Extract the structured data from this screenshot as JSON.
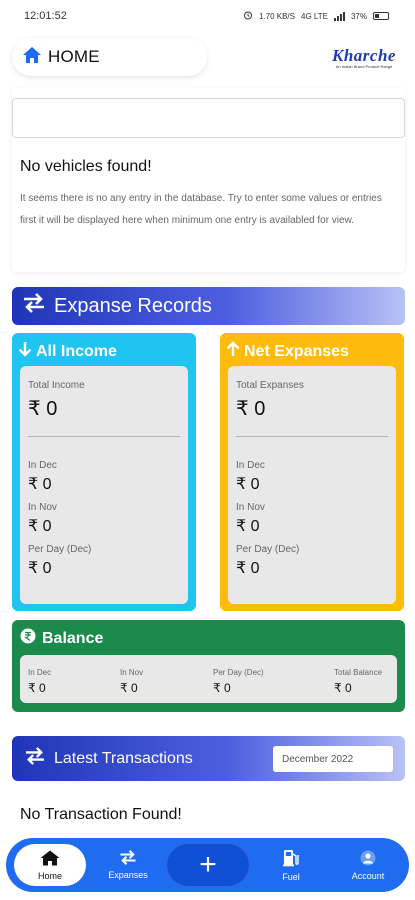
{
  "status": {
    "time": "12:01:52",
    "net_rate": "1.70 KB/S",
    "net_type": "4G LTE",
    "battery": "37%"
  },
  "header": {
    "title": "HOME",
    "logo_text": "Kharche",
    "logo_tagline": "An Indian Brand Product Range"
  },
  "vehicles": {
    "search_value": "",
    "empty_title": "No vehicles found!",
    "empty_text": "It seems there is no any entry in the database. Try to enter some values or entries first it will be displayed here when minimum one entry is availabled for view."
  },
  "expanse_records": {
    "title": "Expanse Records"
  },
  "income": {
    "title": "All Income",
    "total_label": "Total Income",
    "total_value": "₹ 0",
    "dec_label": "In Dec",
    "dec_value": "₹ 0",
    "nov_label": "In Nov",
    "nov_value": "₹ 0",
    "perday_label": "Per Day (Dec)",
    "perday_value": "₹ 0"
  },
  "net": {
    "title": "Net Expanses",
    "total_label": "Total Expanses",
    "total_value": "₹ 0",
    "dec_label": "In Dec",
    "dec_value": "₹ 0",
    "nov_label": "In Nov",
    "nov_value": "₹ 0",
    "perday_label": "Per Day (Dec)",
    "perday_value": "₹ 0"
  },
  "balance": {
    "title": "Balance",
    "cols": [
      {
        "label": "In Dec",
        "value": "₹ 0"
      },
      {
        "label": "In Nov",
        "value": "₹ 0"
      },
      {
        "label": "Per Day (Dec)",
        "value": "₹ 0"
      },
      {
        "label": "Total Balance",
        "value": "₹ 0"
      }
    ]
  },
  "latest": {
    "title": "Latest Transactions",
    "month": "December 2022",
    "empty_title": "No Transaction Found!"
  },
  "nav": {
    "home": "Home",
    "expanses": "Expanses",
    "add": "+",
    "fuel": "Fuel",
    "account": "Account"
  },
  "colors": {
    "income": "#1fc4f0",
    "net": "#ffbc0d",
    "balance": "#1b8a4a",
    "nav": "#1f6cf0",
    "accent": "#1f35b8"
  }
}
